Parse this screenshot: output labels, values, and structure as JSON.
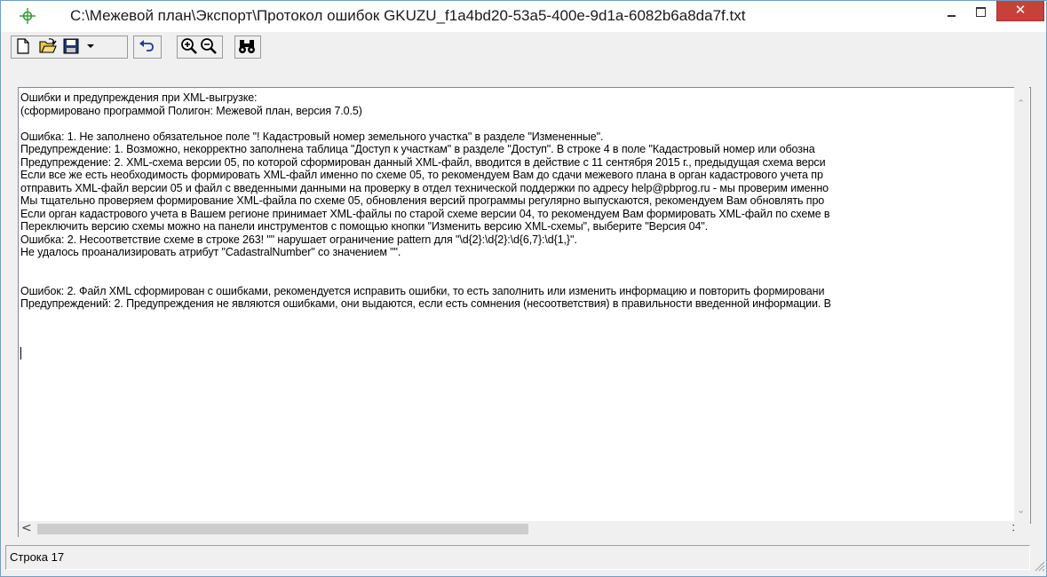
{
  "window": {
    "title": "C:\\Межевой план\\Экспорт\\Протокол ошибок GKUZU_f1a4bd20-53a5-400e-9d1a-6082b6a8da7f.txt",
    "close_glyph": "✕"
  },
  "toolbar": {
    "buttons": [
      {
        "name": "new",
        "icon": "new-document-icon"
      },
      {
        "name": "open",
        "icon": "open-folder-icon"
      },
      {
        "name": "save",
        "icon": "floppy-disk-icon"
      },
      {
        "name": "save-dropdown",
        "icon": "chevron-down-icon"
      },
      {
        "name": "undo",
        "icon": "undo-icon"
      },
      {
        "name": "zoom-in",
        "icon": "zoom-in-icon"
      },
      {
        "name": "zoom-out",
        "icon": "zoom-out-icon"
      },
      {
        "name": "find",
        "icon": "binoculars-icon"
      }
    ]
  },
  "editor": {
    "lines": [
      "Ошибки и предупреждения при XML-выгрузке:",
      "(сформировано программой Полигон: Межевой план, версия 7.0.5)",
      "",
      "Ошибка: 1. Не заполнено обязательное поле \"! Кадастровый номер земельного участка\" в разделе \"Измененные\".",
      "Предупреждение: 1. Возможно, некорректно заполнена таблица \"Доступ к участкам\" в разделе \"Доступ\". В строке 4 в поле \"Кадастровый номер или обозна",
      "Предупреждение: 2. XML-схема версии 05, по которой сформирован данный XML-файл, вводится в действие с 11 сентября 2015 г., предыдущая схема верси",
      "Если все же есть необходимость формировать XML-файл именно по схеме 05, то рекомендуем Вам до сдачи межевого плана в орган кадастрового учета пр",
      "отправить XML-файл версии 05 и файл с введенными данными на проверку в отдел технической поддержки по адресу help@pbprog.ru - мы проверим именно",
      "Мы тщательно проверяем формирование XML-файла по схеме 05, обновления версий программы регулярно выпускаются, рекомендуем Вам обновлять про",
      "Если орган кадастрового учета в Вашем регионе принимает XML-файлы по старой схеме версии 04, то рекомендуем Вам формировать XML-файл по схеме в",
      "Переключить версию схемы можно на панели инструментов с помощью кнопки \"Изменить версию XML-схемы\", выберите \"Версия 04\".",
      "Ошибка: 2. Несоответствие схеме в строке 263! \"\" нарушает ограничение pattern для \"\\d{2}:\\d{2}:\\d{6,7}:\\d{1,}\".",
      "Не удалось проанализировать атрибут \"CadastralNumber\" со значением \"\".",
      "",
      "",
      "Ошибок: 2. Файл XML сформирован с ошибками, рекомендуется исправить ошибки, то есть заполнить или изменить информацию и повторить формировани",
      "Предупреждений: 2. Предупреждения не являются ошибками, они выдаются, если есть сомнения (несоответствия) в правильности введенной информации. В"
    ]
  },
  "scrollbars": {
    "up_glyph": "⌃",
    "down_glyph": "⌄",
    "left_glyph": "<",
    "right_glyph": ">",
    "horizontal_position": 0.0
  },
  "status": {
    "text": "Строка 17"
  }
}
